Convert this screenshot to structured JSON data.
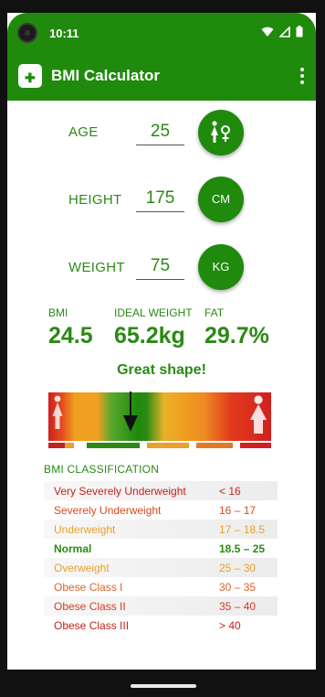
{
  "status_bar": {
    "time": "10:11"
  },
  "app_bar": {
    "title": "BMI Calculator",
    "logo_icon": "medical-bag-icon",
    "menu_icon": "more-vert-icon"
  },
  "inputs": {
    "age": {
      "label": "AGE",
      "value": "25",
      "button_icon": "female-gender-icon"
    },
    "height": {
      "label": "HEIGHT",
      "value": "175",
      "unit": "CM"
    },
    "weight": {
      "label": "WEIGHT",
      "value": "75",
      "unit": "KG"
    }
  },
  "results": {
    "bmi": {
      "label": "BMI",
      "value": "24.5"
    },
    "ideal_weight": {
      "label": "IDEAL WEIGHT",
      "value": "65.2kg"
    },
    "fat": {
      "label": "FAT",
      "value": "29.7%"
    },
    "status": "Great shape!"
  },
  "scale": {
    "indicator_fraction": 0.37
  },
  "classification": {
    "heading": "BMI CLASSIFICATION",
    "rows": [
      {
        "name": "Very Severely Underweight",
        "range": "< 16",
        "color": "#c4221e"
      },
      {
        "name": "Severely Underweight",
        "range": "16 – 17",
        "color": "#d94a1f"
      },
      {
        "name": "Underweight",
        "range": "17 – 18.5",
        "color": "#e8a12b"
      },
      {
        "name": "Normal",
        "range": "18.5 – 25",
        "color": "#2a8a14",
        "active": true
      },
      {
        "name": "Overweight",
        "range": "25 – 30",
        "color": "#e8a12b"
      },
      {
        "name": "Obese Class I",
        "range": "30 – 35",
        "color": "#d9632a"
      },
      {
        "name": "Obese Class II",
        "range": "35 – 40",
        "color": "#d93a22"
      },
      {
        "name": "Obese Class III",
        "range": "> 40",
        "color": "#c4221e"
      }
    ]
  },
  "colors": {
    "accent": "#1f8a0c",
    "text_green": "#2a8a14"
  }
}
